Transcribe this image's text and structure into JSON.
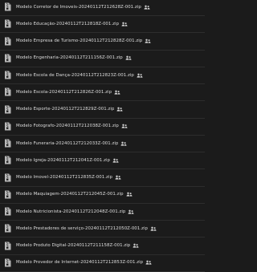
{
  "files": [
    {
      "name": "Modelo Corretor de Imoveis-20240112T212628Z-001.zip",
      "shared_icon": "people-icon"
    },
    {
      "name": "Modelo Educação-20240112T212818Z-001.zip",
      "shared_icon": "people-icon"
    },
    {
      "name": "Modelo Empresa de Turismo-20240112T212828Z-001.zip",
      "shared_icon": "people-icon"
    },
    {
      "name": "Modelo Engenharia-20240112T211156Z-001.zip",
      "shared_icon": "people-icon"
    },
    {
      "name": "Modelo Escola de Dança-20240112T212823Z-001.zip",
      "shared_icon": "people-icon"
    },
    {
      "name": "Modelo Escola-20240112T212826Z-001.zip",
      "shared_icon": "people-icon"
    },
    {
      "name": "Modelo Esporte-20240112T212829Z-001.zip",
      "shared_icon": "people-icon"
    },
    {
      "name": "Modelo Fotografo-20240112T212038Z-001.zip",
      "shared_icon": "people-icon"
    },
    {
      "name": "Modelo Funeraria-20240112T212033Z-001.zip",
      "shared_icon": "people-icon"
    },
    {
      "name": "Modelo Igreja-20240112T212041Z-001.zip",
      "shared_icon": "people-icon"
    },
    {
      "name": "Modelo Imovel-20240112T212835Z-001.zip",
      "shared_icon": "people-icon"
    },
    {
      "name": "Modelo Maquiagem-20240112T212045Z-001.zip",
      "shared_icon": "people-icon"
    },
    {
      "name": "Modelo Nutricionista-20240112T212048Z-001.zip",
      "shared_icon": "people-icon"
    },
    {
      "name": "Modelo Prestadores de serviço-20240112T212050Z-001.zip",
      "shared_icon": "people-icon"
    },
    {
      "name": "Modelo Produto Digital-20240112T211158Z-001.zip",
      "shared_icon": "people-icon"
    },
    {
      "name": "Modelo Provedor de Internet-20240112T212853Z-001.zip",
      "shared_icon": "people-icon"
    }
  ],
  "colors": {
    "background": "#1b1b1b",
    "text": "#dedede",
    "icon_fill": "#b8b8b8",
    "divider": "#2d2d2d"
  }
}
